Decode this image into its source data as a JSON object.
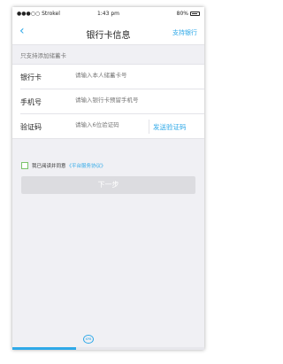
{
  "status_bar": {
    "carrier": "●●●○○ Strokel",
    "time": "1:43 pm",
    "battery": "80%"
  },
  "nav": {
    "back_icon": "chevron-left-icon",
    "title": "银行卡信息",
    "right_link": "支持银行"
  },
  "form": {
    "note": "只支持添加储蓄卡",
    "fields": [
      {
        "label": "银行卡",
        "placeholder": "请输入本人储蓄卡号"
      },
      {
        "label": "手机号",
        "placeholder": "请输入银行卡预留手机号"
      },
      {
        "label": "验证码",
        "placeholder": "请输入6位验证码"
      }
    ],
    "sms_button": "发送验证码"
  },
  "agreement": {
    "text": "我已阅读并同意",
    "link": "《平台服务协议》",
    "checked": false
  },
  "next_button": "下一步",
  "footer_logo_text": "KPB",
  "progress": {
    "value": 0.33
  },
  "colors": {
    "accent": "#2fa9e8",
    "checkbox_border": "#7ac46a",
    "disabled_button": "#dcdce0",
    "background": "#f0f0f4"
  }
}
